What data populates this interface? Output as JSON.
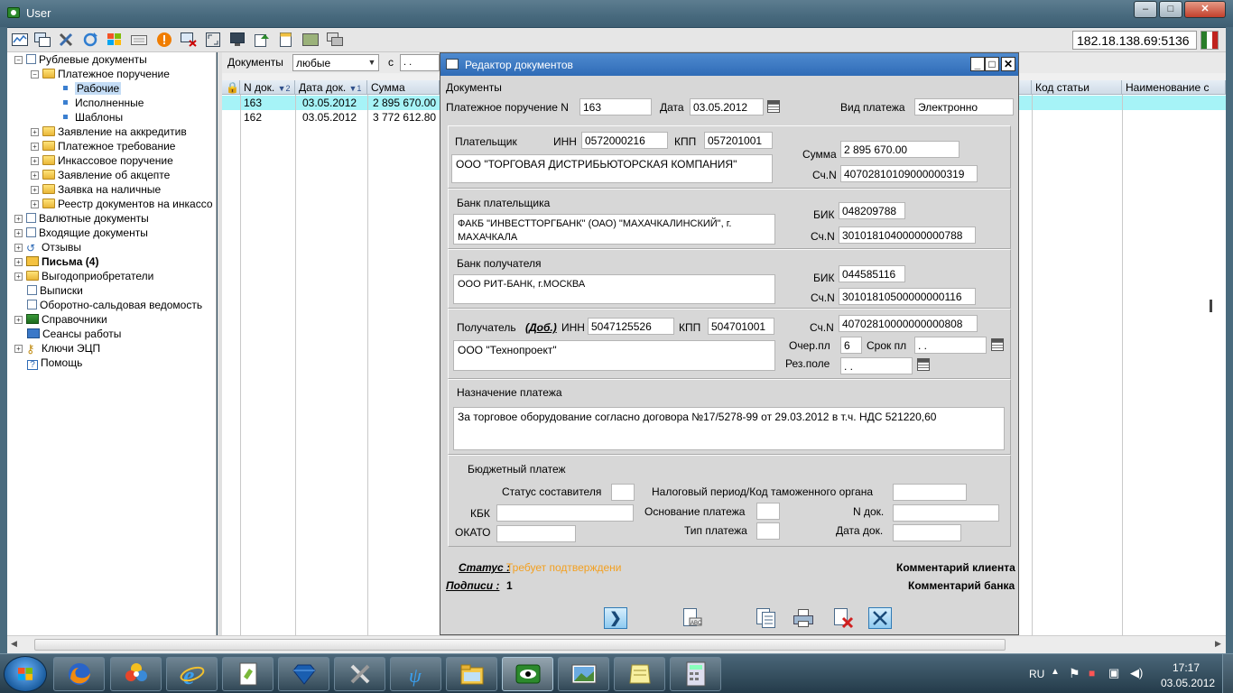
{
  "window": {
    "title": "User"
  },
  "toolbar": {
    "server_address": "182.18.138.69:5136"
  },
  "tree": {
    "items": [
      {
        "label": "Рублевые документы"
      },
      {
        "label": "Платежное поручение"
      },
      {
        "label": "Рабочие"
      },
      {
        "label": "Исполненные"
      },
      {
        "label": "Шаблоны"
      },
      {
        "label": "Заявление на аккредитив"
      },
      {
        "label": "Платежное требование"
      },
      {
        "label": "Инкассовое поручение"
      },
      {
        "label": "Заявление об акцепте"
      },
      {
        "label": "Заявка на наличные"
      },
      {
        "label": "Реестр документов на инкассо"
      },
      {
        "label": "Валютные документы"
      },
      {
        "label": "Входящие документы"
      },
      {
        "label": "Отзывы"
      },
      {
        "label": "Письма (4)"
      },
      {
        "label": "Выгодоприобретатели"
      },
      {
        "label": "Выписки"
      },
      {
        "label": "Оборотно-сальдовая ведомость"
      },
      {
        "label": "Справочники"
      },
      {
        "label": "Сеансы работы"
      },
      {
        "label": "Ключи ЭЦП"
      },
      {
        "label": "Помощь"
      }
    ]
  },
  "filter": {
    "label": "Документы",
    "value": "любые",
    "from_label": "с",
    "date_placeholder": ".   ."
  },
  "grid": {
    "columns": [
      "N док.",
      "Дата док.",
      "Сумма",
      "Код статьи",
      "Наименование с"
    ],
    "sort_marks": [
      "▼2",
      "▼1"
    ],
    "rows": [
      {
        "num": "163",
        "date": "03.05.2012",
        "sum": "2 895 670.00"
      },
      {
        "num": "162",
        "date": "03.05.2012",
        "sum": "3 772 612.80"
      }
    ]
  },
  "dialog": {
    "title": "Редактор документов",
    "section": "Документы",
    "doc_type_label": "Платежное поручение N",
    "doc_number": "163",
    "date_label": "Дата",
    "date": "03.05.2012",
    "payment_kind_label": "Вид платежа",
    "payment_kind": "Электронно",
    "payer": {
      "label": "Плательщик",
      "inn_label": "ИНН",
      "inn": "0572000216",
      "kpp_label": "КПП",
      "kpp": "057201001",
      "name": "ООО \"ТОРГОВАЯ ДИСТРИБЬЮТОРСКАЯ КОМПАНИЯ\"",
      "sum_label": "Сумма",
      "sum": "2 895 670.00",
      "account_label": "Сч.N",
      "account": "40702810109000000319"
    },
    "payer_bank": {
      "label": "Банк плательщика",
      "name": "ФАКБ \"ИНВЕСТТОРГБАНК\" (ОАО) \"МАХАЧКАЛИНСКИЙ\", г. МАХАЧКАЛА",
      "bik_label": "БИК",
      "bik": "048209788",
      "account_label": "Сч.N",
      "account": "30101810400000000788"
    },
    "payee_bank": {
      "label": "Банк получателя",
      "name": "ООО РИТ-БАНК, г.МОСКВА",
      "bik_label": "БИК",
      "bik": "044585116",
      "account_label": "Сч.N",
      "account": "30101810500000000116"
    },
    "payee": {
      "label": "Получатель",
      "extra_link": "(Доб.)",
      "inn_label": "ИНН",
      "inn": "5047125526",
      "kpp_label": "КПП",
      "kpp": "504701001",
      "name": "ООО \"Технопроект\"",
      "account_label": "Сч.N",
      "account": "40702810000000000808",
      "queue_label": "Очер.пл",
      "queue": "6",
      "term_label": "Срок пл",
      "term": ".   .",
      "reserve_label": "Рез.поле",
      "reserve": ".   ."
    },
    "purpose": {
      "label": "Назначение платежа",
      "text": "За торговое оборудование согласно договора №17/5278-99 от 29.03.2012 в т.ч. НДС 521220,60"
    },
    "budget": {
      "label": "Бюджетный платеж",
      "status_label": "Статус составителя",
      "tax_period_label": "Налоговый период/Код таможенного органа",
      "kbk_label": "КБК",
      "basis_label": "Основание платежа",
      "doc_num_label": "N док.",
      "okato_label": "ОКАТО",
      "pay_type_label": "Тип платежа",
      "doc_date_label": "Дата док."
    },
    "status_label": "Статус :",
    "status_value": "Требует подтверждени",
    "signatures_label": "Подписи :",
    "signatures_value": "1",
    "client_comment": "Комментарий клиента",
    "bank_comment": "Комментарий банка"
  },
  "taskbar": {
    "lang": "RU",
    "time": "17:17",
    "date": "03.05.2012"
  },
  "colors": {
    "selected_row": "#a6f3f7",
    "dialog_title": "#2f6bb6",
    "status_value": "#f3a020"
  }
}
